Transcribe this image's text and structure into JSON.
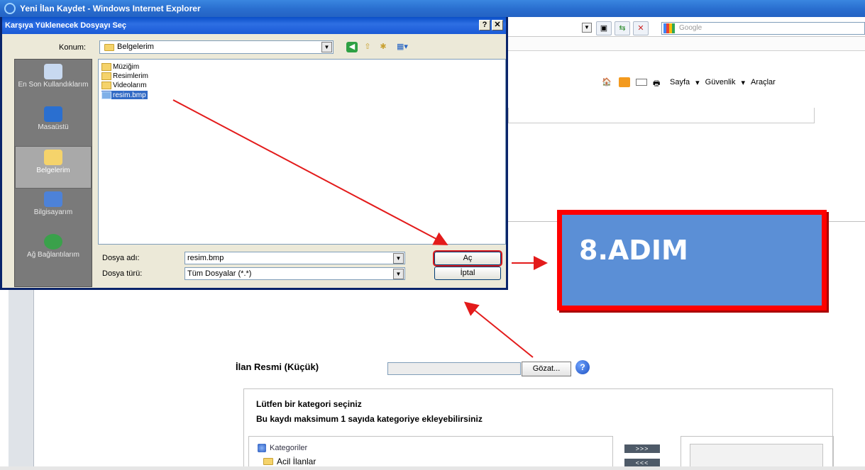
{
  "ie_window": {
    "title": "Yeni İlan Kaydet - Windows Internet Explorer",
    "search_placeholder": "Google",
    "commands": [
      "Sayfa",
      "Güvenlik",
      "Araçlar"
    ]
  },
  "dialog": {
    "title": "Karşıya Yüklenecek Dosyayı Seç",
    "help_btn": "?",
    "close_btn": "✕",
    "konum_label": "Konum:",
    "konum_value": "Belgelerim",
    "places": [
      "En Son Kullandıklarım",
      "Masaüstü",
      "Belgelerim",
      "Bilgisayarım",
      "Ağ Bağlantılarım"
    ],
    "files": [
      "Müziğim",
      "Resimlerim",
      "Videolarım",
      "resim.bmp"
    ],
    "filename_label": "Dosya adı:",
    "filename_value": "resim.bmp",
    "filetype_label": "Dosya türü:",
    "filetype_value": "Tüm Dosyalar (*.*)",
    "open_btn": "Aç",
    "cancel_btn": "İptal"
  },
  "callout": {
    "text": "8.ADIM",
    "fill": "#5b8fd6",
    "border": "#ff0000"
  },
  "page": {
    "image_label": "İlan Resmi (Küçük)",
    "browse_btn": "Gözat...",
    "help_icon": "?",
    "category_line1": "Lütfen bir kategori seçiniz",
    "category_line2": "Bu kaydı maksimum 1 sayıda kategoriye ekleyebilirsiniz",
    "tree_root": "Kategoriler",
    "tree_child": "Acil İlanlar",
    "add_btn": ">>>",
    "remove_btn": "<<<"
  },
  "colors": {
    "arrow": "#e31b1b",
    "selection": "#316ac5"
  }
}
